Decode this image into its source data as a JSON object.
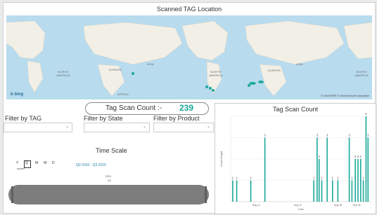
{
  "map": {
    "title": "Scanned TAG Location",
    "labels": {
      "north_america": "NORTH AMERICA",
      "europe": "EUROPE",
      "asia": "ASIA",
      "africa": "AFRICA"
    },
    "bing_logo": "b bing",
    "copyright": "© 2016 HERE   © 2016 Microsoft Corporation",
    "colors": {
      "water": "#b8dbee",
      "land": "#f2efe6",
      "pin": "#1ba99a"
    }
  },
  "tag_count": {
    "label": "Tag Scan Count :-",
    "value": "239"
  },
  "filters": [
    {
      "label": "Filter by TAG"
    },
    {
      "label": "Filter by State"
    },
    {
      "label": "Filter by Product"
    }
  ],
  "time_scale": {
    "title": "Time Scale",
    "slicer_items": [
      "Y",
      "Q",
      "M",
      "W",
      "D"
    ],
    "slicer_caption": "quarter",
    "range_text": "Q3 2016 - Q3 2016",
    "year_label": "2016",
    "quarter_label": "Q3"
  },
  "chart_data": {
    "type": "bar",
    "title": "Tag Scan Count",
    "xlabel": "Date",
    "ylabel": "Count of tagId",
    "x_ticks": [
      "Aug 14",
      "Aug 21",
      "Aug 28",
      "Sep 04"
    ],
    "ylim": [
      0,
      4
    ],
    "bar_color": "#1ba99a",
    "bars": [
      {
        "x": 0.3,
        "value": 1
      },
      {
        "x": 0.9,
        "value": 1
      },
      {
        "x": 3.0,
        "value": 1
      },
      {
        "x": 5.1,
        "value": 3
      },
      {
        "x": 12.4,
        "value": 1
      },
      {
        "x": 12.9,
        "value": 3
      },
      {
        "x": 13.2,
        "value": 2
      },
      {
        "x": 13.6,
        "value": 1
      },
      {
        "x": 14.4,
        "value": 3
      },
      {
        "x": 15.2,
        "value": 1
      },
      {
        "x": 16.0,
        "value": 1
      },
      {
        "x": 17.7,
        "value": 3
      },
      {
        "x": 18.1,
        "value": 1
      },
      {
        "x": 18.6,
        "value": 2
      },
      {
        "x": 19.0,
        "value": 2
      },
      {
        "x": 19.4,
        "value": 2
      },
      {
        "x": 19.8,
        "value": 1
      },
      {
        "x": 20.2,
        "value": 4
      },
      {
        "x": 20.5,
        "value": 3
      }
    ]
  }
}
